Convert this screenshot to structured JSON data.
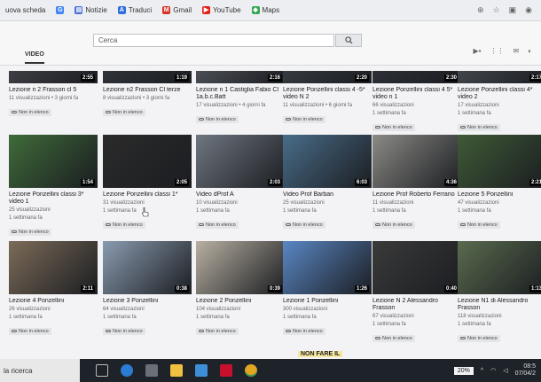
{
  "bookmarks": [
    {
      "label": "uova scheda",
      "color": "#bbbbbb",
      "icon": "blank-icon"
    },
    {
      "label": "",
      "color": "#4285f4",
      "icon": "google-icon"
    },
    {
      "label": "Notizie",
      "color": "#4a6fd8",
      "icon": "news-icon"
    },
    {
      "label": "Traduci",
      "color": "#2f6ee0",
      "icon": "translate-icon"
    },
    {
      "label": "Gmail",
      "color": "#d93025",
      "icon": "gmail-icon"
    },
    {
      "label": "YouTube",
      "color": "#e62117",
      "icon": "youtube-icon"
    },
    {
      "label": "Maps",
      "color": "#34a853",
      "icon": "maps-icon"
    }
  ],
  "search": {
    "placeholder": "Cerca"
  },
  "tabs": {
    "active": "VIDEO"
  },
  "badge_label": "Non in elenco",
  "row1": [
    {
      "title": "Lezione n 2 Frasson cl 5",
      "meta1": "11 visualizzazioni • 3 giorni fa",
      "duration": "2:55"
    },
    {
      "title": "Lezione n2 Frasson Cl terze",
      "meta1": "8 visualizzazioni • 3 giorni fa",
      "duration": "1:19"
    },
    {
      "title": "Lezione n 1 Castiglia Fabio Cl 1a.b.c.Batt",
      "meta1": "17 visualizzazioni • 4 giorni fa",
      "duration": "2:16"
    },
    {
      "title": "Lezione Ponzellini classi 4 -5* video N 2",
      "meta1": "11 visualizzazioni • 6 giorni fa",
      "duration": "2:20"
    },
    {
      "title": "Lezione Ponzellini classi 4 5* video n 1",
      "meta1": "66 visualizzazioni",
      "meta2": "1 settimana fa",
      "duration": "2:30"
    },
    {
      "title": "Lezione Ponzellini classi 4* video 2",
      "meta1": "17 visualizzazioni",
      "meta2": "1 settimana fa",
      "duration": "2:17"
    }
  ],
  "row2": [
    {
      "title": "Lezione Ponzellini classi 3* video 1",
      "meta1": "25 visualizzazioni",
      "meta2": "1 settimana fa",
      "duration": "1:54"
    },
    {
      "title": "Lezione Ponzellini classi 1*",
      "meta1": "31 visualizzazioni",
      "meta2": "1 settimana fa",
      "duration": "2:05"
    },
    {
      "title": "Video dProf A",
      "meta1": "10 visualizzazioni",
      "meta2": "1 settimana fa",
      "duration": "2:03"
    },
    {
      "title": "Video Prof Barban",
      "meta1": "25 visualizzazioni",
      "meta2": "1 settimana fa",
      "duration": "6:03"
    },
    {
      "title": "Lezione Prof Roberto Ferrario",
      "meta1": "11 visualizzazioni",
      "meta2": "1 settimana fa",
      "duration": "4:36"
    },
    {
      "title": "Lezione 5 Ponzellini",
      "meta1": "47 visualizzazioni",
      "meta2": "1 settimana fa",
      "duration": "2:21"
    }
  ],
  "row3": [
    {
      "title": "Lezione 4 Ponzellini",
      "meta1": "26 visualizzazioni",
      "meta2": "1 settimana fa",
      "duration": "2:11"
    },
    {
      "title": "Lezione 3 Ponzellini",
      "meta1": "64 visualizzazioni",
      "meta2": "1 settimana fa",
      "duration": "0:38"
    },
    {
      "title": "Lezione 2 Ponzellini",
      "meta1": "104 visualizzazioni",
      "meta2": "1 settimana fa",
      "duration": "0:39"
    },
    {
      "title": "Lezione 1 Ponzellini",
      "meta1": "300 visualizzazioni",
      "meta2": "1 settimana fa",
      "duration": "1:26"
    },
    {
      "title": "Lezione N 2 Alessandro Frasson",
      "meta1": "67 visualizzazioni",
      "meta2": "1 settimana fa",
      "duration": "0:40"
    },
    {
      "title": "Lezione N1 di Alessandro Frasson",
      "meta1": "118 visualizzazioni",
      "meta2": "1 settimana fa",
      "duration": "1:13"
    }
  ],
  "taskbar": {
    "search_label": "la ricerca",
    "battery": "20%",
    "time": "08:5",
    "date": "07/04/2"
  },
  "row4_text": "NON FARE IL"
}
